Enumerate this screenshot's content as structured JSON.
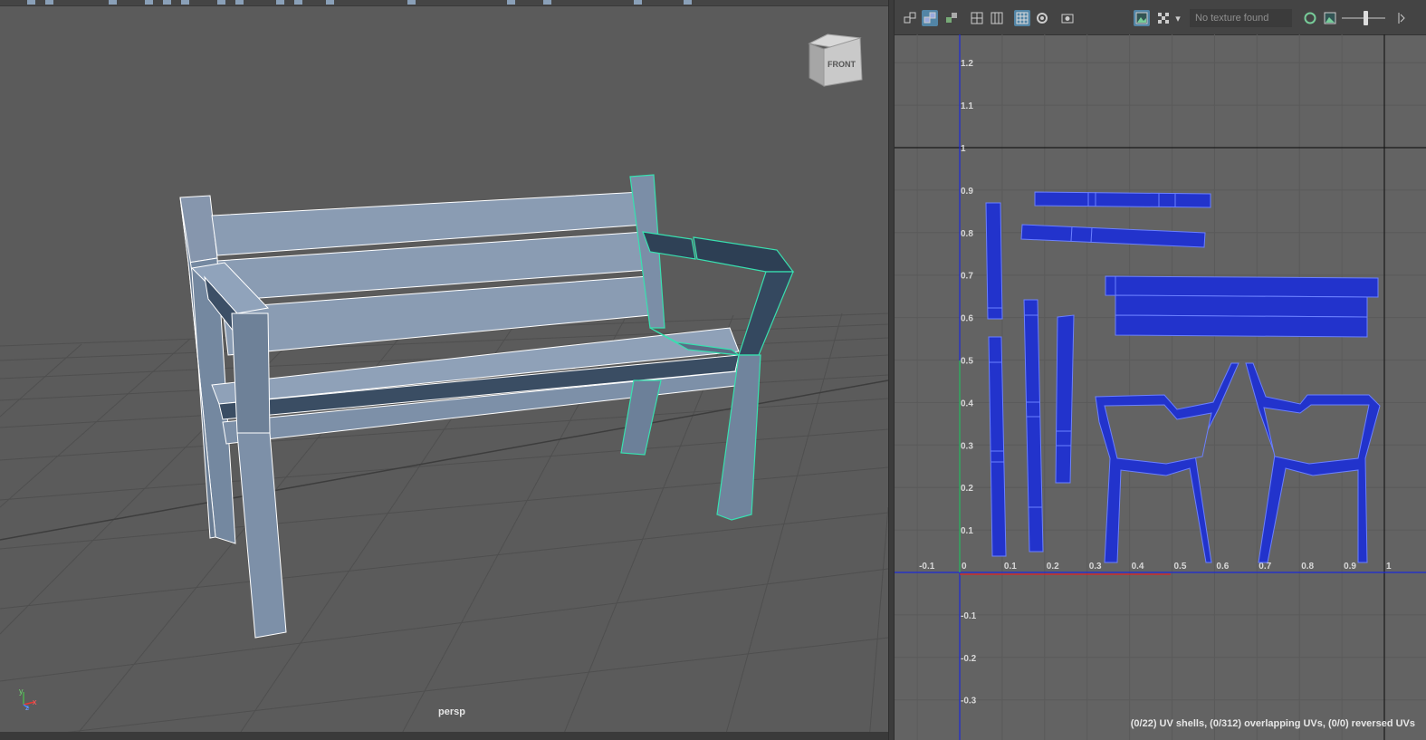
{
  "viewport": {
    "camera_label": "persp",
    "viewcube_label": "FRONT",
    "axis_labels": {
      "x": "x",
      "y": "y",
      "z": "z"
    }
  },
  "uv_editor": {
    "texture_field": "No texture found",
    "status": "(0/22) UV shells, (0/312) overlapping UVs, (0/0) reversed UVs",
    "x_ticks": [
      "-0.1",
      "0",
      "0.1",
      "0.2",
      "0.3",
      "0.4",
      "0.5",
      "0.6",
      "0.7",
      "0.8",
      "0.9",
      "1"
    ],
    "y_ticks": [
      "1.2",
      "1.1",
      "1",
      "0.9",
      "0.8",
      "0.7",
      "0.6",
      "0.5",
      "0.4",
      "0.3",
      "0.2",
      "0.1",
      "-0.1",
      "-0.2",
      "-0.3"
    ],
    "toolbar_icons": [
      "uv-layout-icon",
      "uv-shaded-icon",
      "uv-distortion-icon",
      "grid-icon",
      "pixel-snap-icon",
      "frame-icon",
      "isolate-icon",
      "snapshot-icon",
      "image-display-icon",
      "checker-icon",
      "dropdown-icon",
      "rgb-channels-icon",
      "image-ratio-icon",
      "expand-icon"
    ]
  },
  "colors": {
    "uv_fill": "#2233cc",
    "uv_outline": "#5f75ff",
    "bench": "#7d8fa8",
    "bench_dark": "#3a4e63",
    "selection": "#38e0b0",
    "grid_bg": "#5b5b5b"
  }
}
